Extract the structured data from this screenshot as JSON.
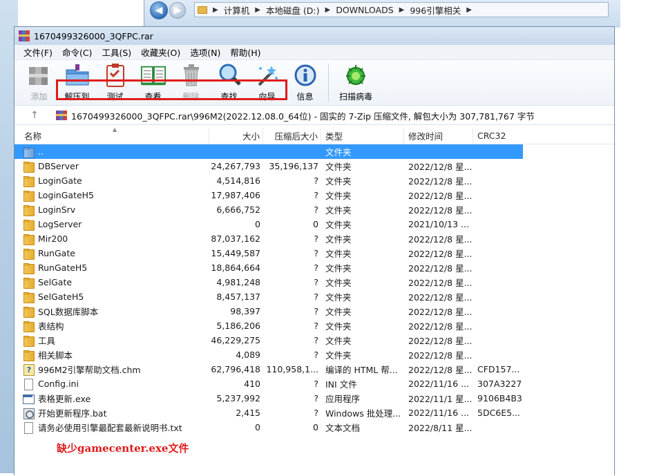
{
  "explorer": {
    "breadcrumb": [
      "计算机",
      "本地磁盘 (D:)",
      "DOWNLOADS",
      "996引擎相关"
    ]
  },
  "window": {
    "title": "1670499326000_3QFPC.rar"
  },
  "menu": [
    "文件(F)",
    "命令(C)",
    "工具(S)",
    "收藏夹(O)",
    "选项(N)",
    "帮助(H)"
  ],
  "toolbar": {
    "add": "添加",
    "extract": "解压到",
    "test": "测试",
    "view": "查看",
    "delete": "删除",
    "find": "查找",
    "wizard": "向导",
    "info": "信息",
    "virus": "扫描病毒"
  },
  "path": {
    "text": "1670499326000_3QFPC.rar\\996M2(2022.12.08.0_64位) - 固实的 7-Zip 压缩文件, 解包大小为 307,781,767 字节"
  },
  "columns": {
    "name": "名称",
    "size": "大小",
    "packed": "压缩后大小",
    "type": "类型",
    "modified": "修改时间",
    "crc": "CRC32"
  },
  "rows": [
    {
      "name": "..",
      "size": "",
      "packed": "",
      "type": "文件夹",
      "modified": "",
      "crc": "",
      "icon": "folder-up-icon"
    },
    {
      "name": "DBServer",
      "size": "24,267,793",
      "packed": "35,196,137",
      "type": "文件夹",
      "modified": "2022/12/8 星...",
      "crc": "",
      "icon": "folder-icon"
    },
    {
      "name": "LoginGate",
      "size": "4,514,816",
      "packed": "?",
      "type": "文件夹",
      "modified": "2022/12/8 星...",
      "crc": "",
      "icon": "folder-icon"
    },
    {
      "name": "LoginGateH5",
      "size": "17,987,406",
      "packed": "?",
      "type": "文件夹",
      "modified": "2022/12/8 星...",
      "crc": "",
      "icon": "folder-icon"
    },
    {
      "name": "LoginSrv",
      "size": "6,666,752",
      "packed": "?",
      "type": "文件夹",
      "modified": "2022/12/8 星...",
      "crc": "",
      "icon": "folder-icon"
    },
    {
      "name": "LogServer",
      "size": "0",
      "packed": "0",
      "type": "文件夹",
      "modified": "2021/10/13 ...",
      "crc": "",
      "icon": "folder-icon"
    },
    {
      "name": "Mir200",
      "size": "87,037,162",
      "packed": "?",
      "type": "文件夹",
      "modified": "2022/12/8 星...",
      "crc": "",
      "icon": "folder-icon"
    },
    {
      "name": "RunGate",
      "size": "15,449,587",
      "packed": "?",
      "type": "文件夹",
      "modified": "2022/12/8 星...",
      "crc": "",
      "icon": "folder-icon"
    },
    {
      "name": "RunGateH5",
      "size": "18,864,664",
      "packed": "?",
      "type": "文件夹",
      "modified": "2022/12/8 星...",
      "crc": "",
      "icon": "folder-icon"
    },
    {
      "name": "SelGate",
      "size": "4,981,248",
      "packed": "?",
      "type": "文件夹",
      "modified": "2022/12/8 星...",
      "crc": "",
      "icon": "folder-icon"
    },
    {
      "name": "SelGateH5",
      "size": "8,457,137",
      "packed": "?",
      "type": "文件夹",
      "modified": "2022/12/8 星...",
      "crc": "",
      "icon": "folder-icon"
    },
    {
      "name": "SQL数据库脚本",
      "size": "98,397",
      "packed": "?",
      "type": "文件夹",
      "modified": "2022/12/8 星...",
      "crc": "",
      "icon": "folder-icon"
    },
    {
      "name": "表结构",
      "size": "5,186,206",
      "packed": "?",
      "type": "文件夹",
      "modified": "2022/12/8 星...",
      "crc": "",
      "icon": "folder-icon"
    },
    {
      "name": "工具",
      "size": "46,229,275",
      "packed": "?",
      "type": "文件夹",
      "modified": "2022/12/8 星...",
      "crc": "",
      "icon": "folder-icon"
    },
    {
      "name": "相关脚本",
      "size": "4,089",
      "packed": "?",
      "type": "文件夹",
      "modified": "2022/12/8 星...",
      "crc": "",
      "icon": "folder-icon"
    },
    {
      "name": "996M2引擎帮助文档.chm",
      "size": "62,796,418",
      "packed": "110,958,1...",
      "type": "编译的 HTML 帮...",
      "modified": "2022/12/8 星...",
      "crc": "CFD157...",
      "icon": "chm-icon"
    },
    {
      "name": "Config.ini",
      "size": "410",
      "packed": "?",
      "type": "INI 文件",
      "modified": "2022/11/16 ...",
      "crc": "307A3227",
      "icon": "file-icon"
    },
    {
      "name": "表格更新.exe",
      "size": "5,237,992",
      "packed": "?",
      "type": "应用程序",
      "modified": "2022/11/1 星...",
      "crc": "9106B4B3",
      "icon": "exe-icon"
    },
    {
      "name": "开始更新程序.bat",
      "size": "2,415",
      "packed": "?",
      "type": "Windows 批处理...",
      "modified": "2022/11/16 ...",
      "crc": "5DC6E5...",
      "icon": "bat-icon"
    },
    {
      "name": "请务必使用引擎最配套最新说明书.txt",
      "size": "0",
      "packed": "0",
      "type": "文本文档",
      "modified": "2022/8/11 星...",
      "crc": "",
      "icon": "file-icon"
    }
  ],
  "annotation": "缺少gamecenter.exe文件",
  "colors": {
    "selection": "#3399ff",
    "highlight_box": "#e01b1b"
  }
}
